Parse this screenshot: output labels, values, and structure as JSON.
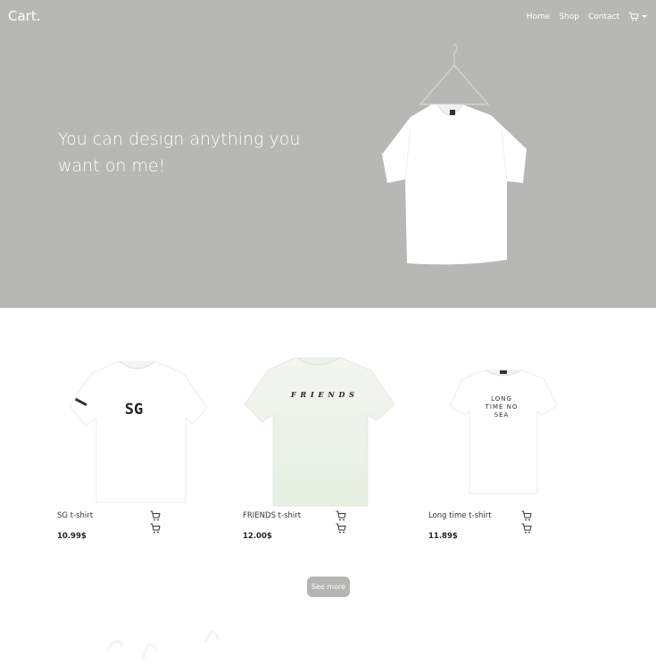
{
  "brand": "Cart.",
  "nav": {
    "home": "Home",
    "shop": "Shop",
    "contact": "Contact"
  },
  "hero": {
    "headline": "You can design anything you want on me!"
  },
  "products": [
    {
      "name": "SG t-shirt",
      "price": "10.99$",
      "print": "SG"
    },
    {
      "name": "FRIENDS t-shirt",
      "price": "12.00$",
      "print": "F R I E N D S"
    },
    {
      "name": "Long time t-shirt",
      "price": "11.89$",
      "print": "LONG TIME NO SEA"
    }
  ],
  "see_more": "See more",
  "colors": {
    "hero_bg": "#b7b7b5",
    "button_bg": "#b5b5b3"
  }
}
